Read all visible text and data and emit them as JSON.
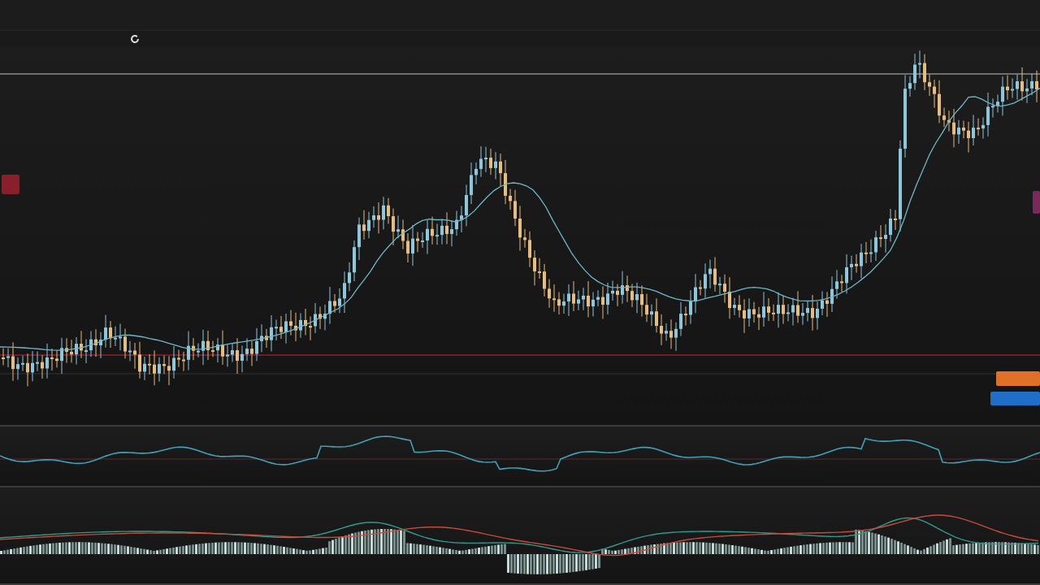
{
  "panels": [
    {
      "kind": "candles"
    },
    {
      "kind": "oscillator"
    },
    {
      "kind": "macd"
    }
  ],
  "markers": [
    {
      "color": "#8a1f2c"
    },
    {
      "color": "#7a2a5a"
    },
    {
      "color": "#e07028"
    },
    {
      "color": "#1f6fc8"
    }
  ]
}
